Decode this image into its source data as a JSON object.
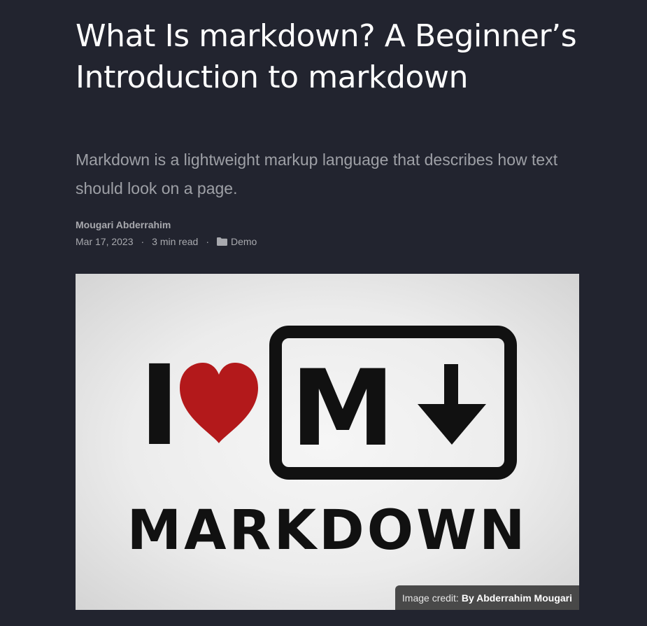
{
  "post": {
    "title": "What Is markdown? A Beginner’s Introduction to markdown",
    "description": "Markdown is a lightweight markup language that describes how text should look on a page.",
    "author": "Mougari Abderrahim",
    "date": "Mar 17, 2023",
    "separator": "·",
    "read_time": "3 min read",
    "category": "Demo",
    "category_icon": "folder-icon"
  },
  "preview": {
    "logo_text": "MARKDOWN",
    "logo_letter_i": "I",
    "logo_letter_m": "M",
    "heart_color": "#b3191b",
    "caption_label": "Image credit:",
    "caption_credit": "By Abderrahim Mougari"
  },
  "colors": {
    "background": "#22242f",
    "title": "#ffffff",
    "muted": "#9ea0a6"
  }
}
